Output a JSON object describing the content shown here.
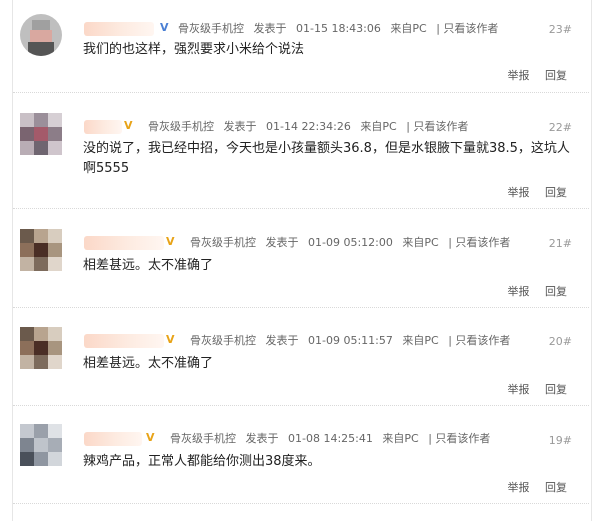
{
  "posts": [
    {
      "user_level": "骨灰级手机控",
      "posted_label": "发表于",
      "time": "01-15 18:43:06",
      "source": "来自PC",
      "only_author": "| 只看该作者",
      "floor": "23#",
      "badge": "V",
      "content": "我们的也这样，强烈要求小米给个说法",
      "report": "举报",
      "reply": "回复"
    },
    {
      "user_level": "骨灰级手机控",
      "posted_label": "发表于",
      "time": "01-14 22:34:26",
      "source": "来自PC",
      "only_author": "| 只看该作者",
      "floor": "22#",
      "badge": "V",
      "content": "没的说了，我已经中招，今天也是小孩量额头36.8，但是水银腋下量就38.5，这坑人啊5555",
      "report": "举报",
      "reply": "回复"
    },
    {
      "user_level": "骨灰级手机控",
      "posted_label": "发表于",
      "time": "01-09 05:12:00",
      "source": "来自PC",
      "only_author": "| 只看该作者",
      "floor": "21#",
      "badge": "V",
      "content": "相差甚远。太不准确了",
      "report": "举报",
      "reply": "回复"
    },
    {
      "user_level": "骨灰级手机控",
      "posted_label": "发表于",
      "time": "01-09 05:11:57",
      "source": "来自PC",
      "only_author": "| 只看该作者",
      "floor": "20#",
      "badge": "V",
      "content": "相差甚远。太不准确了",
      "report": "举报",
      "reply": "回复"
    },
    {
      "user_level": "骨灰级手机控",
      "posted_label": "发表于",
      "time": "01-08 14:25:41",
      "source": "来自PC",
      "only_author": "| 只看该作者",
      "floor": "19#",
      "badge": "V",
      "content": "辣鸡产品，正常人都能给你测出38度来。",
      "report": "举报",
      "reply": "回复"
    }
  ],
  "colors": {
    "vip_blue": "#4a7fd4",
    "vip_gold": "#e8a317",
    "text": "#222222",
    "meta": "#666666",
    "floor": "#999999"
  }
}
